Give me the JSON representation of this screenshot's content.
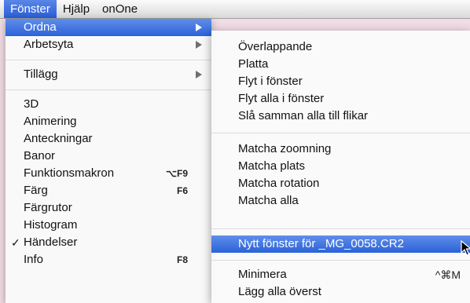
{
  "menubar": {
    "items": [
      "Fönster",
      "Hjälp",
      "onOne"
    ]
  },
  "menu": {
    "items": [
      {
        "label": "Ordna",
        "submenu": true,
        "selected": true
      },
      {
        "label": "Arbetsyta",
        "submenu": true
      },
      {
        "label": "Tillägg",
        "submenu": true
      },
      {
        "label": "3D"
      },
      {
        "label": "Animering"
      },
      {
        "label": "Anteckningar"
      },
      {
        "label": "Banor"
      },
      {
        "label": "Funktionsmakron",
        "shortcut": "⌥F9"
      },
      {
        "label": "Färg",
        "shortcut": "F6"
      },
      {
        "label": "Färgrutor"
      },
      {
        "label": "Histogram"
      },
      {
        "label": "Händelser",
        "checked": true
      },
      {
        "label": "Info",
        "shortcut": "F8"
      }
    ]
  },
  "submenu": {
    "items": [
      {
        "label": "Överlappande"
      },
      {
        "label": "Platta"
      },
      {
        "label": "Flyt i fönster"
      },
      {
        "label": "Flyt alla i fönster"
      },
      {
        "label": "Slå samman alla till flikar"
      },
      {
        "label": "Matcha zoomning"
      },
      {
        "label": "Matcha plats"
      },
      {
        "label": "Matcha rotation"
      },
      {
        "label": "Matcha alla"
      },
      {
        "label": "Nytt fönster för _MG_0058.CR2",
        "selected": true
      },
      {
        "label": "Minimera",
        "shortcut": "^⌘M"
      },
      {
        "label": "Lägg alla överst"
      }
    ]
  },
  "colors": {
    "selection": "#2b62d9",
    "background": "#f2dde6"
  },
  "icons": {
    "check": "checkmark-icon",
    "arrow": "submenu-arrow-icon",
    "cursor": "mouse-pointer-icon"
  }
}
